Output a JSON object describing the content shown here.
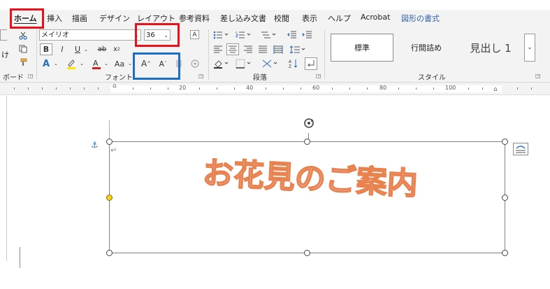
{
  "tabs": [
    {
      "label": "ホーム",
      "active": true
    },
    {
      "label": "挿入"
    },
    {
      "label": "描画"
    },
    {
      "label": "デザイン"
    },
    {
      "label": "レイアウト"
    },
    {
      "label": "参考資料"
    },
    {
      "label": "差し込み文書"
    },
    {
      "label": "校閲"
    },
    {
      "label": "表示"
    },
    {
      "label": "ヘルプ"
    },
    {
      "label": "Acrobat"
    },
    {
      "label": "図形の書式",
      "contextual": true
    }
  ],
  "clipboard": {
    "paste_label": "け",
    "group_label": "ボード"
  },
  "font": {
    "name": "メイリオ",
    "size": "36",
    "group_label": "フォント",
    "bold": "B",
    "italic": "I",
    "underline": "U",
    "strike": "ab",
    "subscript": "x",
    "clear_format": "A",
    "grow_font": "A",
    "shrink_font": "A",
    "change_case": "Aa"
  },
  "paragraph": {
    "group_label": "段落"
  },
  "styles": {
    "group_label": "スタイル",
    "items": [
      "標準",
      "行間詰め",
      "見出し 1"
    ]
  },
  "ruler": {
    "marks": [
      "20",
      "40",
      "60",
      "80",
      "100"
    ]
  },
  "wordart": {
    "text": "お花見のご案内"
  },
  "colors": {
    "highlight_red": "#e8111c",
    "highlight_blue": "#1a6fc9",
    "wordart_fill": "#f7b9c6",
    "wordart_outline": "#e8834f",
    "font_color_bar": "#d21f1f",
    "highlight_bar": "#ffe400"
  }
}
